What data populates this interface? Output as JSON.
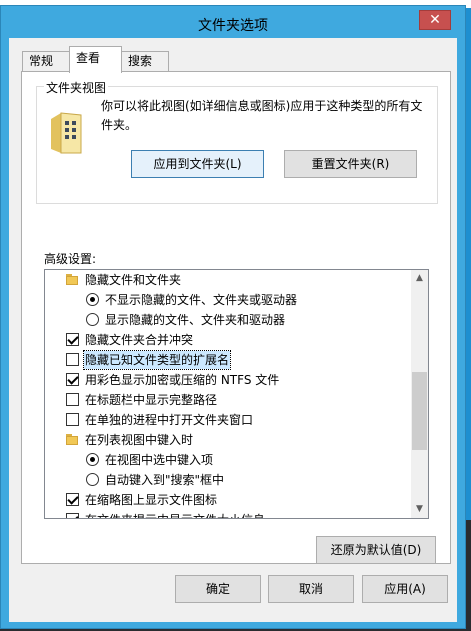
{
  "dialog": {
    "title": "文件夹选项",
    "close_glyph": "✕"
  },
  "tabs": [
    {
      "label": "常规",
      "active": false
    },
    {
      "label": "查看",
      "active": true
    },
    {
      "label": "搜索",
      "active": false
    }
  ],
  "folder_views": {
    "title": "文件夹视图",
    "description": "你可以将此视图(如详细信息或图标)应用于这种类型的所有文件夹。",
    "apply_button": "应用到文件夹(L)",
    "reset_button": "重置文件夹(R)"
  },
  "advanced": {
    "label": "高级设置:",
    "items": [
      {
        "kind": "folder",
        "label": "隐藏文件和文件夹"
      },
      {
        "kind": "radio",
        "checked": true,
        "label": "不显示隐藏的文件、文件夹或驱动器"
      },
      {
        "kind": "radio",
        "checked": false,
        "label": "显示隐藏的文件、文件夹和驱动器"
      },
      {
        "kind": "checkbox",
        "checked": true,
        "label": "隐藏文件夹合并冲突"
      },
      {
        "kind": "checkbox",
        "checked": false,
        "label": "隐藏已知文件类型的扩展名",
        "selected": true
      },
      {
        "kind": "checkbox",
        "checked": true,
        "label": "用彩色显示加密或压缩的 NTFS 文件"
      },
      {
        "kind": "checkbox",
        "checked": false,
        "label": "在标题栏中显示完整路径"
      },
      {
        "kind": "checkbox",
        "checked": false,
        "label": "在单独的进程中打开文件夹窗口"
      },
      {
        "kind": "folder",
        "label": "在列表视图中键入时"
      },
      {
        "kind": "radio",
        "checked": true,
        "label": "在视图中选中键入项"
      },
      {
        "kind": "radio",
        "checked": false,
        "label": "自动键入到\"搜索\"框中"
      },
      {
        "kind": "checkbox",
        "checked": true,
        "label": "在缩略图上显示文件图标"
      },
      {
        "kind": "checkbox",
        "checked": true,
        "label": "在文件夹提示中显示文件大小信息"
      }
    ],
    "restore_button": "还原为默认值(D)"
  },
  "footer": {
    "ok": "确定",
    "cancel": "取消",
    "apply": "应用(A)"
  },
  "colors": {
    "window_frame": "#3fa9df",
    "close_button": "#c7504f",
    "selection": "#cce8ff"
  }
}
